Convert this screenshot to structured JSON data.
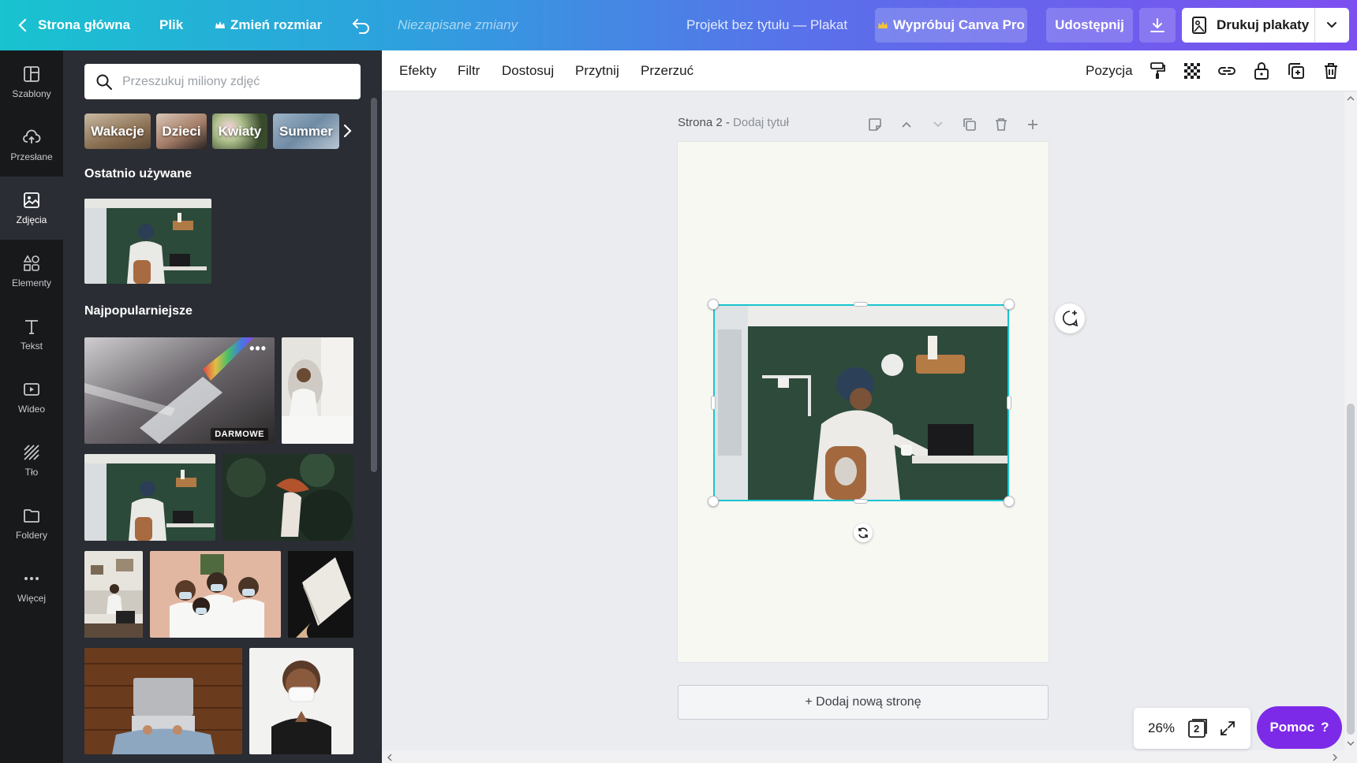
{
  "topbar": {
    "home": "Strona główna",
    "file": "Plik",
    "resize": "Zmień rozmiar",
    "unsaved": "Niezapisane zmiany",
    "project_title": "Projekt bez tytułu — Plakat",
    "try_pro": "Wypróbuj Canva Pro",
    "share": "Udostępnij",
    "print": "Drukuj plakaty"
  },
  "rail": {
    "items": [
      {
        "label": "Szablony",
        "icon": "templates-icon"
      },
      {
        "label": "Przesłane",
        "icon": "upload-cloud-icon"
      },
      {
        "label": "Zdjęcia",
        "icon": "image-icon"
      },
      {
        "label": "Elementy",
        "icon": "shapes-icon"
      },
      {
        "label": "Tekst",
        "icon": "text-icon"
      },
      {
        "label": "Wideo",
        "icon": "video-icon"
      },
      {
        "label": "Tło",
        "icon": "background-icon"
      },
      {
        "label": "Foldery",
        "icon": "folder-icon"
      },
      {
        "label": "Więcej",
        "icon": "more-icon"
      }
    ]
  },
  "panel": {
    "search_placeholder": "Przeszukuj miliony zdjęć",
    "chips": [
      "Wakacje",
      "Dzieci",
      "Kwiaty",
      "Summer"
    ],
    "recent_title": "Ostatnio używane",
    "popular_title": "Najpopularniejsze",
    "free_badge": "DARMOWE"
  },
  "toolbar": {
    "effects": "Efekty",
    "filter": "Filtr",
    "adjust": "Dostosuj",
    "crop": "Przytnij",
    "flip": "Przerzuć",
    "position": "Pozycja"
  },
  "canvas": {
    "page_label": "Strona 2 - ",
    "page_title_placeholder": "Dodaj tytuł",
    "add_page": "+ Dodaj nową stronę"
  },
  "footer": {
    "zoom": "26%",
    "page_count": "2",
    "help": "Pomoc"
  },
  "colors": {
    "accent": "#19c3cf",
    "brand_purple": "#7d2ae8",
    "panel_bg": "#2a2d33",
    "rail_bg": "#18191b"
  }
}
